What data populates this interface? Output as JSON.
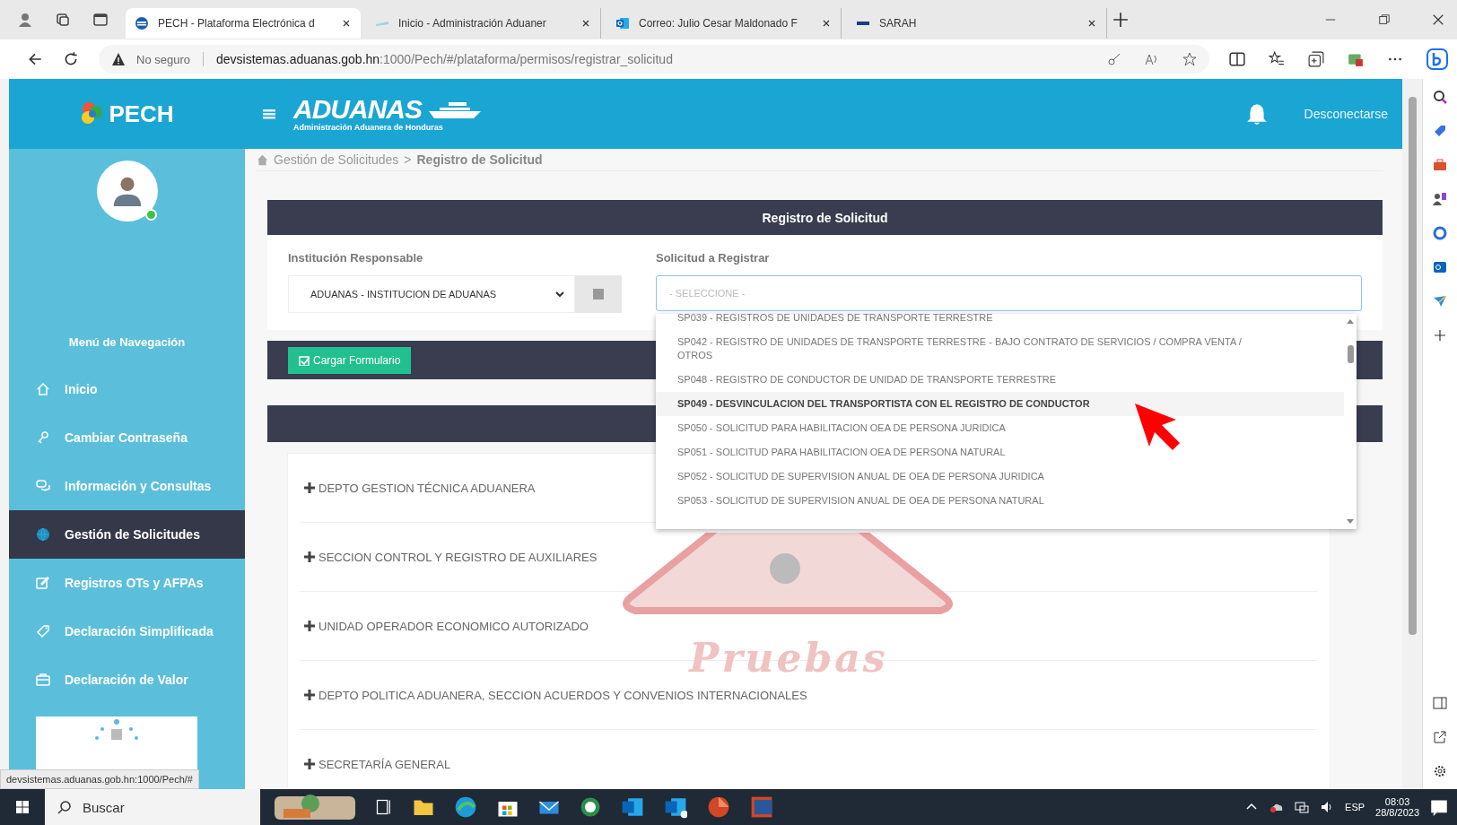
{
  "browser": {
    "tabs": [
      {
        "title": "PECH - Plataforma Electrónica d",
        "selected": true,
        "kind": "pech"
      },
      {
        "title": "Inicio - Administración Aduaner",
        "selected": false,
        "kind": "aduanas"
      },
      {
        "title": "Correo: Julio Cesar Maldonado F",
        "selected": false,
        "kind": "outlook"
      },
      {
        "title": "SARAH",
        "selected": false,
        "kind": "sarah"
      }
    ],
    "security": "No seguro",
    "url_host": "devsistemas.aduanas.gob.hn",
    "url_path": ":1000/Pech/#/plataforma/permisos/registrar_solicitud"
  },
  "header": {
    "logo": "PECH",
    "brand": "ADUANAS",
    "brand_subtitle": "Administración Aduanera de Honduras",
    "logout": "Desconectarse"
  },
  "breadcrumb": {
    "items": [
      "Gestión de Solicitudes",
      "Registro de Solicitud"
    ],
    "separator": ">"
  },
  "sidebar": {
    "menu_title": "Menú de Navegación",
    "items": [
      {
        "label": "Inicio",
        "kind": "home",
        "selected": false
      },
      {
        "label": "Cambiar Contraseña",
        "kind": "key",
        "selected": false
      },
      {
        "label": "Información y Consultas",
        "kind": "chat",
        "selected": false
      },
      {
        "label": "Gestión de Solicitudes",
        "kind": "globe",
        "selected": true
      },
      {
        "label": "Registros OTs y AFPAs",
        "kind": "edit",
        "selected": false
      },
      {
        "label": "Declaración Simplificada",
        "kind": "tag",
        "selected": false
      },
      {
        "label": "Declaración de Valor",
        "kind": "briefcase",
        "selected": false
      }
    ]
  },
  "form": {
    "title": "Registro de Solicitud",
    "institution_label": "Institución Responsable",
    "institution_value": "ADUANAS - INSTITUCION DE ADUANAS",
    "request_label": "Solicitud a Registrar",
    "request_placeholder": "- SELECCIONE -",
    "expanded": true,
    "load_button": "Cargar Formulario"
  },
  "dropdown_options": [
    {
      "label": "SP039 - REGISTROS DE UNIDADES DE TRANSPORTE TERRESTRE",
      "selected": false
    },
    {
      "label": "SP042 - REGISTRO DE UNIDADES DE TRANSPORTE TERRESTRE - BAJO CONTRATO DE SERVICIOS / COMPRA VENTA / OTROS",
      "selected": false
    },
    {
      "label": "SP048 - REGISTRO DE CONDUCTOR DE UNIDAD DE TRANSPORTE TERRESTRE",
      "selected": false
    },
    {
      "label": "SP049 - DESVINCULACION DEL TRANSPORTISTA CON EL REGISTRO DE CONDUCTOR",
      "selected": true
    },
    {
      "label": "SP050 - SOLICITUD PARA HABILITACION OEA DE PERSONA JURIDICA",
      "selected": false
    },
    {
      "label": "SP051 - SOLICITUD PARA HABILITACION OEA DE PERSONA NATURAL",
      "selected": false
    },
    {
      "label": "SP052 - SOLICITUD DE SUPERVISION ANUAL DE OEA DE PERSONA JURIDICA",
      "selected": false
    },
    {
      "label": "SP053 - SOLICITUD DE SUPERVISION ANUAL DE OEA DE PERSONA NATURAL",
      "selected": false
    }
  ],
  "sections": [
    {
      "label": "DEPTO GESTION TÉCNICA ADUANERA"
    },
    {
      "label": "SECCION CONTROL Y REGISTRO DE AUXILIARES"
    },
    {
      "label": "UNIDAD OPERADOR ECONOMICO AUTORIZADO"
    },
    {
      "label": "DEPTO POLITICA ADUANERA, SECCION ACUERDOS Y CONVENIOS INTERNACIONALES"
    },
    {
      "label": "SECRETARÍA GENERAL"
    }
  ],
  "watermark": "Pruebas",
  "status_url": "devsistemas.aduanas.gob.hn:1000/Pech/#",
  "taskbar": {
    "search_placeholder": "Buscar",
    "language": "ESP",
    "time": "08:03",
    "date": "28/8/2023"
  }
}
